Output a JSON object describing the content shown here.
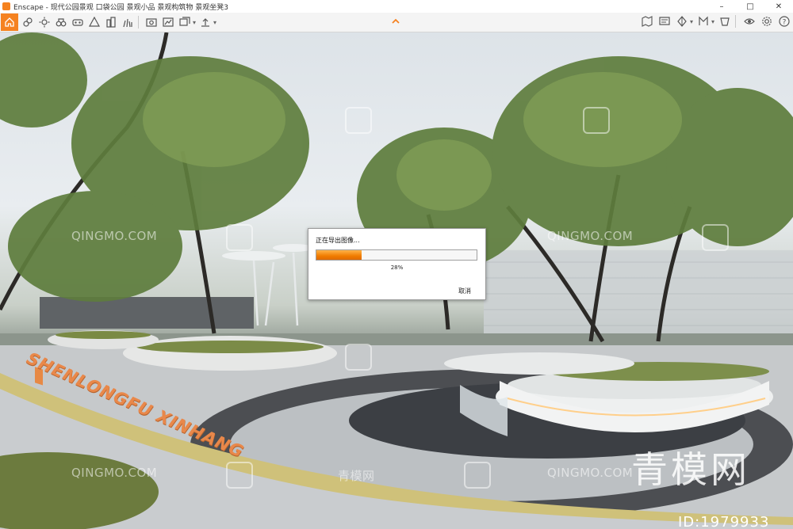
{
  "window": {
    "app_title": "Enscape - 现代公园景观 口袋公园 景观小品 景观构筑物 景观坐凳3",
    "minimize": "–",
    "maximize": "□",
    "close": "✕"
  },
  "toolbar": {
    "accent": "#f58220",
    "left_icons": [
      "home-icon",
      "link-icon",
      "sun-icon",
      "binoculars-icon",
      "vr-icon",
      "asset-icon",
      "buildings-icon",
      "grass-icon",
      "capture-icon",
      "render-icon",
      "batch-icon",
      "upload-icon"
    ],
    "right_icons": [
      "map-icon",
      "display-icon",
      "visual-icon",
      "material-icon",
      "palette-icon",
      "eye-icon",
      "settings-icon",
      "help-icon"
    ]
  },
  "dialog": {
    "title": "正在导出图像...",
    "progress": 0.28,
    "progress_text": "28%",
    "cancel_label": "取消"
  },
  "scene": {
    "sign_text": "SHENLONGFU XINHANG"
  },
  "watermarks": {
    "site_text": "QINGMO.COM",
    "site_cn": "青模网",
    "brand_big": "青模网",
    "id_text": "ID:1979933"
  }
}
